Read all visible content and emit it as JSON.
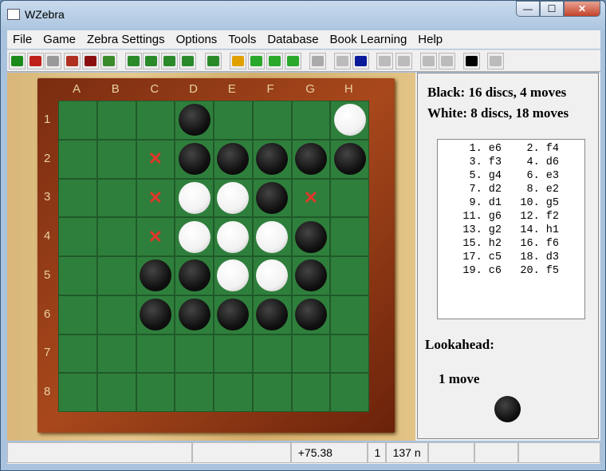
{
  "window": {
    "title": "WZebra",
    "min": "—",
    "max": "☐",
    "close": "✕"
  },
  "menu": [
    "File",
    "Game",
    "Zebra Settings",
    "Options",
    "Tools",
    "Database",
    "Book Learning",
    "Help"
  ],
  "toolbar": [
    {
      "name": "new-game",
      "color": "#1a8a1a"
    },
    {
      "name": "zebra-book",
      "color": "#c0201a"
    },
    {
      "name": "disabled-1",
      "color": "#999"
    },
    {
      "name": "load",
      "color": "#b03020"
    },
    {
      "name": "save",
      "color": "#8a1010"
    },
    {
      "name": "open-folder",
      "color": "#3a8a2a"
    },
    {
      "name": "move-now",
      "color": "#2a8a2a"
    },
    {
      "name": "analyze",
      "color": "#2a8a2a"
    },
    {
      "name": "analyze-game",
      "color": "#2a8a2a"
    },
    {
      "name": "zz",
      "color": "#2a8a2a"
    },
    {
      "name": "drop-move",
      "color": "#2a8a2a"
    },
    {
      "name": "stop",
      "color": "#e0a000"
    },
    {
      "name": "flip-board",
      "color": "#29a829"
    },
    {
      "name": "rotate",
      "color": "#29a829"
    },
    {
      "name": "undo-rotate",
      "color": "#29a829"
    },
    {
      "name": "disabled-2",
      "color": "#aaa"
    },
    {
      "name": "first-move",
      "color": "#bbb"
    },
    {
      "name": "back-move",
      "color": "#0a1a9a"
    },
    {
      "name": "down",
      "color": "#bbb"
    },
    {
      "name": "hint",
      "color": "#bbb"
    },
    {
      "name": "forward-move",
      "color": "#bbb"
    },
    {
      "name": "last-move",
      "color": "#bbb"
    },
    {
      "name": "side-to-move",
      "color": "#000"
    },
    {
      "name": "pause",
      "color": "#bbb"
    }
  ],
  "board": {
    "cols": [
      "A",
      "B",
      "C",
      "D",
      "E",
      "F",
      "G",
      "H"
    ],
    "rows": [
      "1",
      "2",
      "3",
      "4",
      "5",
      "6",
      "7",
      "8"
    ],
    "cells": [
      "...B...W",
      "..xBBBBB",
      "..xWWBx.",
      "..xWWWB.",
      "..BBWWB.",
      "..BBBBB.",
      "........",
      "........"
    ]
  },
  "panel": {
    "black": "Black:  16 discs, 4 moves",
    "white": "White:  8 discs, 18 moves",
    "moves": [
      "1. e6",
      "2. f4",
      "3. f3",
      "4. d6",
      "5. g4",
      "6. e3",
      "7. d2",
      "8. e2",
      "9. d1",
      "10. g5",
      "11. g6",
      "12. f2",
      "13. g2",
      "14. h1",
      "15. h2",
      "16. f6",
      "17. c5",
      "18. d3",
      "19. c6",
      "20. f5"
    ],
    "lookahead_label": "Lookahead:",
    "lookahead_value": "1 move"
  },
  "status": [
    "",
    "",
    "+75.38",
    "1",
    "137 n",
    "",
    "",
    ""
  ]
}
